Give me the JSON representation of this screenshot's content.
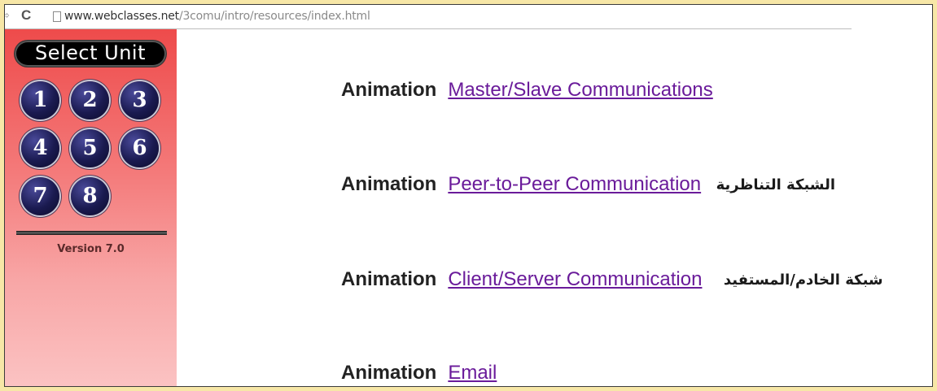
{
  "browser": {
    "url_host": "www.webclasses.net",
    "url_path": "/3comu/intro/resources/index.html",
    "back_glyph": "⇨",
    "reload_glyph": "C"
  },
  "sidebar": {
    "title": "Select Unit",
    "units": [
      "1",
      "2",
      "3",
      "4",
      "5",
      "6",
      "7",
      "8"
    ],
    "version": "Version 7.0"
  },
  "main": {
    "items": [
      {
        "label": "Animation",
        "link": "Master/Slave Communications",
        "arabic": ""
      },
      {
        "label": "Animation",
        "link": "Peer-to-Peer Communication",
        "arabic": "الشبكة التناظرية"
      },
      {
        "label": "Animation",
        "link": "Client/Server Communication",
        "arabic": "شبكة الخادم/المستفيد"
      },
      {
        "label": "Animation",
        "link": "Email",
        "arabic": ""
      }
    ]
  },
  "colors": {
    "link": "#6a1b9a",
    "outer_frame": "#f7e7a7",
    "sidebar_top": "#ee4b4b"
  },
  "icons": {
    "navigation": "forward-arrow-icon",
    "reload": "reload-icon",
    "page": "page-icon"
  }
}
